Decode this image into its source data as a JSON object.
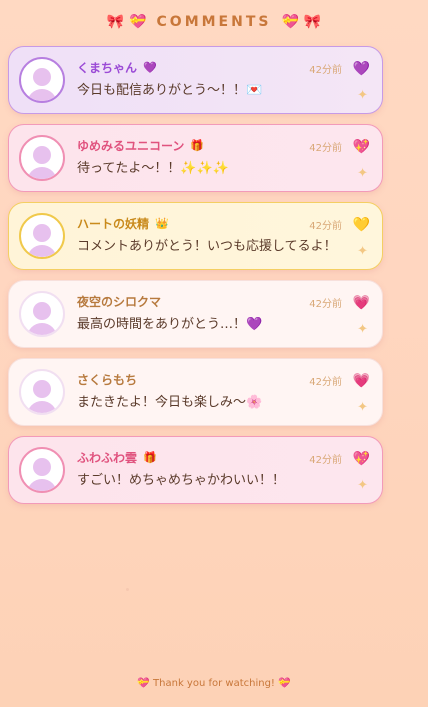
{
  "header": {
    "left_icons": "🎀  💝",
    "title": "COMMENTS",
    "right_icons": "💝  🎀"
  },
  "comments": [
    {
      "name": "くまちゃん",
      "badge": "💜",
      "time": "42分前",
      "message": "今日も配信ありがとう〜！！💌",
      "heart": "💜",
      "theme": "purple"
    },
    {
      "name": "ゆめみるユニコーン",
      "badge": "🎁",
      "time": "42分前",
      "message": "待ってたよ〜！！✨✨✨",
      "heart": "💖",
      "theme": "pink"
    },
    {
      "name": "ハートの妖精",
      "badge": "👑",
      "time": "42分前",
      "message": "コメントありがとう！いつも応援してるよ！",
      "heart": "💛",
      "theme": "gold"
    },
    {
      "name": "夜空のシロクマ",
      "badge": "",
      "time": "42分前",
      "message": "最高の時間をありがとう…！💜",
      "heart": "💗",
      "theme": "white"
    },
    {
      "name": "さくらもち",
      "badge": "",
      "time": "42分前",
      "message": "またきたよ！今日も楽しみ〜🌸",
      "heart": "💗",
      "theme": "white"
    },
    {
      "name": "ふわふわ雲",
      "badge": "🎁",
      "time": "42分前",
      "message": "すごい！めちゃめちゃかわいい！！",
      "heart": "💖",
      "theme": "pink"
    }
  ],
  "sparkle": "✦",
  "footer": "💝 Thank you for watching! 💝"
}
